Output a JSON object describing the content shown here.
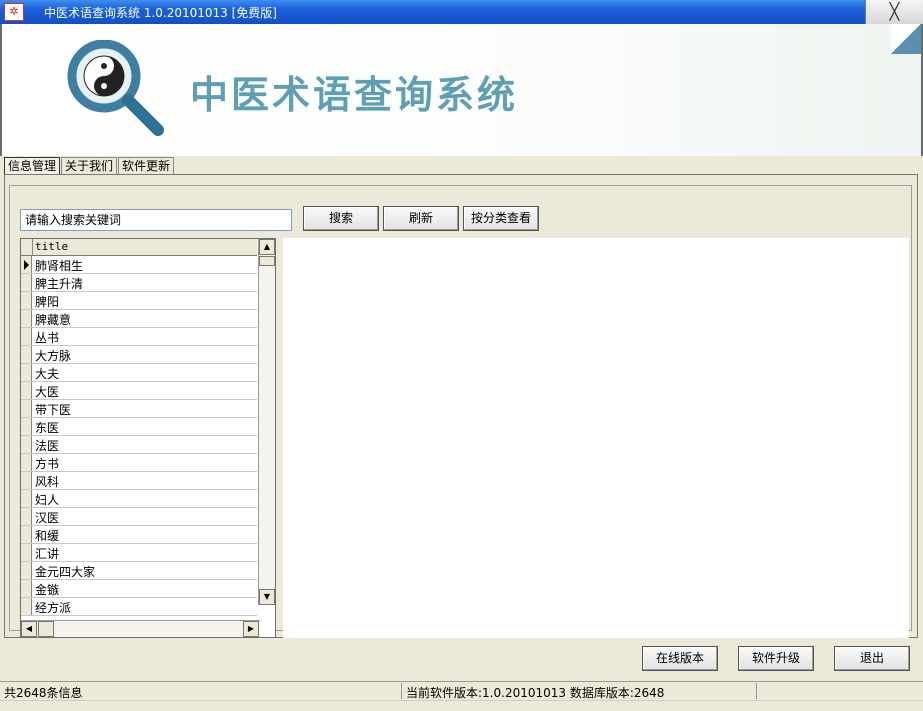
{
  "window": {
    "title": "中医术语查询系统 1.0.20101013 [免费版]",
    "close_glyph": "╳"
  },
  "banner": {
    "title": "中医术语查询系统"
  },
  "tabs": [
    {
      "label": "信息管理"
    },
    {
      "label": "关于我们"
    },
    {
      "label": "软件更新"
    }
  ],
  "search": {
    "value": "请输入搜索关键词",
    "search_label": "搜索",
    "refresh_label": "刷新",
    "category_label": "按分类查看"
  },
  "grid": {
    "column": "title",
    "rows": [
      "肺肾相生",
      "脾主升清",
      "脾阳",
      "脾藏意",
      "丛书",
      "大方脉",
      "大夫",
      "大医",
      "带下医",
      "东医",
      "法医",
      "方书",
      "风科",
      "妇人",
      "汉医",
      "和缓",
      "汇讲",
      "金元四大家",
      "金镞",
      "经方派"
    ],
    "up_glyph": "▲",
    "down_glyph": "▼",
    "left_glyph": "◀",
    "right_glyph": "▶"
  },
  "footer": {
    "online_label": "在线版本",
    "upgrade_label": "软件升级",
    "exit_label": "退出"
  },
  "status": {
    "count_text": "共2648条信息",
    "version_text": "当前软件版本:1.0.20101013 数据库版本:2648"
  }
}
